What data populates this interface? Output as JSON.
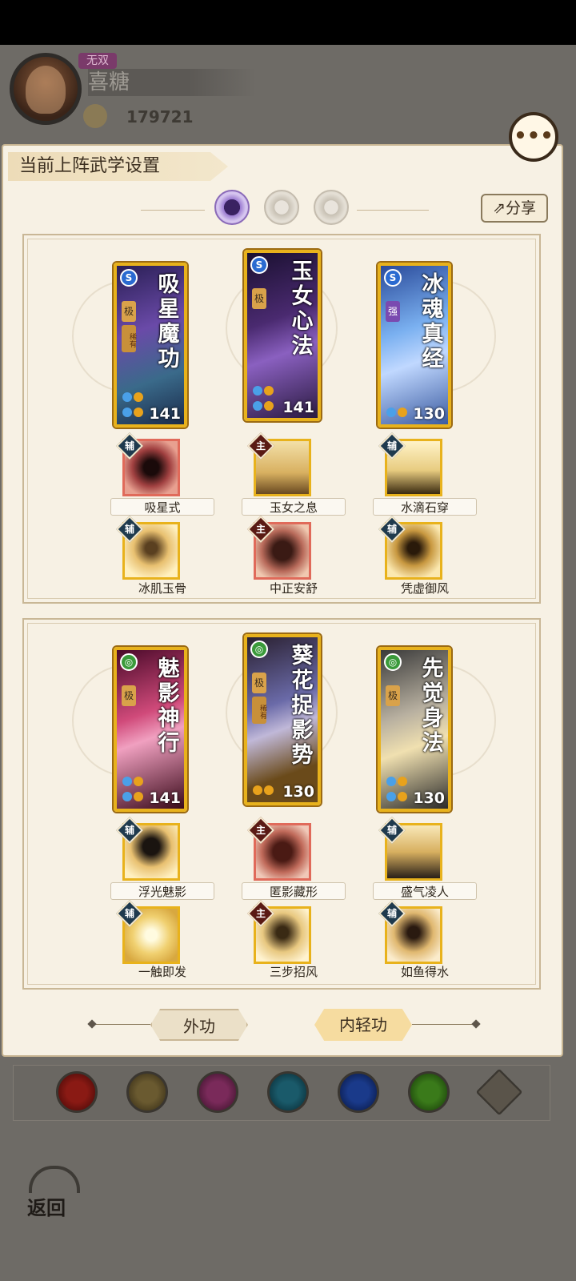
{
  "player": {
    "title_tag": "无双",
    "name": "喜糖",
    "power": "179721"
  },
  "panel": {
    "title": "当前上阵武学设置",
    "share_label": "分享"
  },
  "groups": [
    {
      "cards": [
        {
          "name": "吸星魔功",
          "level": "141",
          "grade": "极",
          "rarity": "稀有"
        },
        {
          "name": "玉女心法",
          "level": "141",
          "grade": "极",
          "rarity": ""
        },
        {
          "name": "冰魂真经",
          "level": "130",
          "grade": "强",
          "rarity": ""
        }
      ],
      "skills_row1": [
        {
          "tag": "辅",
          "label": "吸星式"
        },
        {
          "tag": "主",
          "label": "玉女之息"
        },
        {
          "tag": "辅",
          "label": "水滴石穿"
        }
      ],
      "skills_row2": [
        {
          "tag": "辅",
          "label": "冰肌玉骨"
        },
        {
          "tag": "主",
          "label": "中正安舒"
        },
        {
          "tag": "辅",
          "label": "凭虚御风"
        }
      ]
    },
    {
      "cards": [
        {
          "name": "魅影神行",
          "level": "141",
          "grade": "极",
          "rarity": ""
        },
        {
          "name": "葵花捉影势",
          "level": "130",
          "grade": "极",
          "rarity": "稀有"
        },
        {
          "name": "先觉身法",
          "level": "130",
          "grade": "极",
          "rarity": ""
        }
      ],
      "skills_row1": [
        {
          "tag": "辅",
          "label": "浮光魅影"
        },
        {
          "tag": "主",
          "label": "匿影藏形"
        },
        {
          "tag": "辅",
          "label": "盛气凌人"
        }
      ],
      "skills_row2": [
        {
          "tag": "辅",
          "label": "一触即发"
        },
        {
          "tag": "主",
          "label": "三步招风"
        },
        {
          "tag": "辅",
          "label": "如鱼得水"
        }
      ]
    }
  ],
  "bottom_tabs": {
    "outer": "外功",
    "inner": "内轻功"
  },
  "back_label": "返回",
  "colors": {
    "accent_gold": "#e8b21c",
    "panel_bg": "#f7f1e4",
    "aux_tag": "#1f3a4e",
    "main_tag": "#5a1a14"
  }
}
